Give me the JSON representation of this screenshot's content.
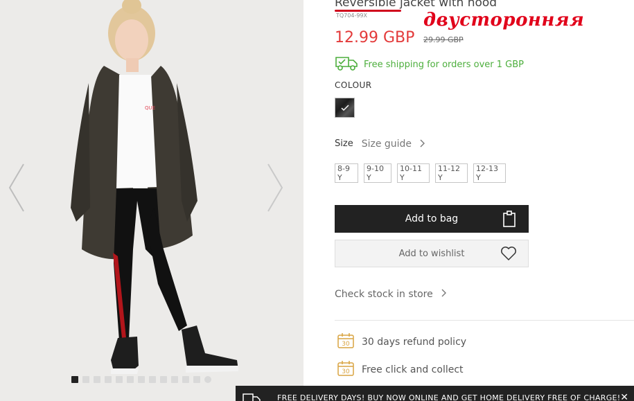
{
  "product": {
    "title": "Reversible jacket with hood",
    "sku": "TQ704-99X",
    "annotation": "двусторонняя",
    "price": "12.99 GBP",
    "old_price": "29.99 GBP",
    "shipping": "Free shipping for orders over 1 GBP",
    "colour_label": "COLOUR",
    "size_label": "Size",
    "size_guide": "Size guide",
    "sizes": [
      "8-9 Y",
      "9-10 Y",
      "10-11 Y",
      "11-12 Y",
      "12-13 Y"
    ],
    "add_to_bag": "Add to bag",
    "add_to_wishlist": "Add to wishlist",
    "check_stock": "Check stock in store",
    "refund_policy": "30 days refund policy",
    "click_collect": "Free click and collect",
    "policy_icon_number": "30"
  },
  "banner": {
    "text": "FREE DELIVERY DAYS! BUY NOW ONLINE AND GET HOME DELIVERY FREE OF CHARGE!",
    "close": "✕"
  },
  "gallery": {
    "dot_count": 13,
    "active_index": 0
  },
  "colors": {
    "price": "#e33a3a",
    "shipping": "#4cae3c",
    "annotation": "#e1001a",
    "policy_icon": "#d9a441"
  }
}
